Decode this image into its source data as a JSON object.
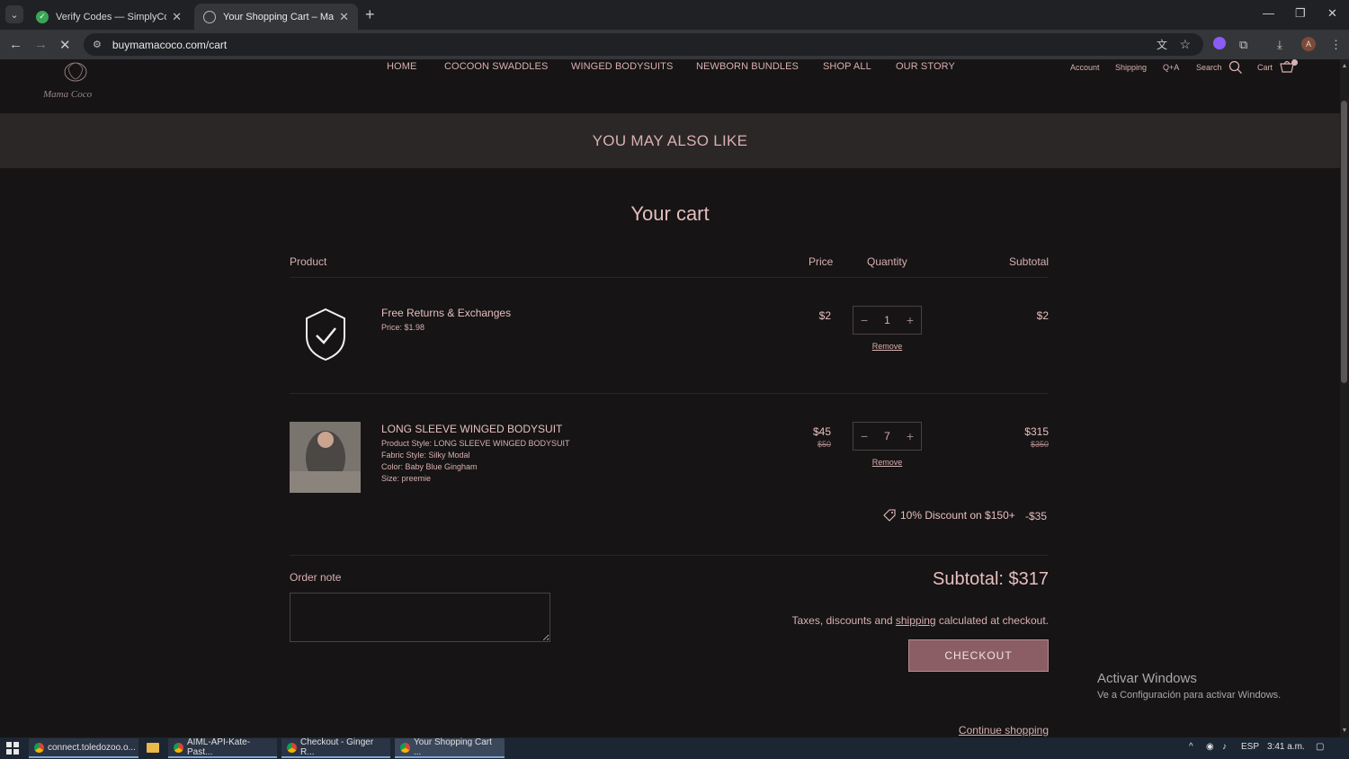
{
  "browser": {
    "tabs": [
      {
        "title": "Verify Codes — SimplyCodes",
        "active": false
      },
      {
        "title": "Your Shopping Cart – Mama Co",
        "active": true
      }
    ],
    "url": "buymamacoco.com/cart",
    "profile_initial": "A"
  },
  "site": {
    "logo_text": "Mama Coco",
    "nav": [
      "HOME",
      "COCOON SWADDLES",
      "WINGED BODYSUITS",
      "NEWBORN BUNDLES",
      "SHOP ALL",
      "OUR STORY"
    ],
    "utility": {
      "account": "Account",
      "shipping": "Shipping",
      "qa": "Q+A",
      "search": "Search",
      "cart": "Cart"
    }
  },
  "banner": {
    "text": "YOU MAY ALSO LIKE"
  },
  "cart": {
    "title": "Your cart",
    "headers": {
      "product": "Product",
      "price": "Price",
      "quantity": "Quantity",
      "subtotal": "Subtotal"
    },
    "items": [
      {
        "name": "Free Returns & Exchanges",
        "meta": [
          "Price: $1.98"
        ],
        "price": "$2",
        "price_old": "",
        "quantity": "1",
        "subtotal": "$2",
        "subtotal_old": "",
        "remove": "Remove"
      },
      {
        "name": "LONG SLEEVE WINGED BODYSUIT",
        "meta": [
          "Product Style: LONG SLEEVE WINGED BODYSUIT",
          "Fabric Style: Silky Modal",
          "Color: Baby Blue Gingham",
          "Size: preemie"
        ],
        "price": "$45",
        "price_old": "$50",
        "quantity": "7",
        "subtotal": "$315",
        "subtotal_old": "$350",
        "remove": "Remove"
      }
    ],
    "discount": {
      "label": "10% Discount on $150+",
      "amount": "-$35"
    },
    "order_note_label": "Order note",
    "order_note_value": "",
    "subtotal_text": "Subtotal: $317",
    "taxes_prefix": "Taxes, discounts and ",
    "taxes_link": "shipping",
    "taxes_suffix": " calculated at checkout.",
    "checkout": "CHECKOUT",
    "continue": "Continue shopping"
  },
  "windows_notice": {
    "line1": "Activar Windows",
    "line2": "Ve a Configuración para activar Windows."
  },
  "taskbar": {
    "apps": [
      "connect.toledozoo.o...",
      "AIML-API-Kate-Past...",
      "Checkout - Ginger R...",
      "Your Shopping Cart ..."
    ],
    "lang": "ESP",
    "time": "3:41 a.m."
  },
  "colors": {
    "accent": "#d9b0b0",
    "background": "#161415",
    "banner": "#2b2727",
    "checkout": "#8a5e64"
  }
}
